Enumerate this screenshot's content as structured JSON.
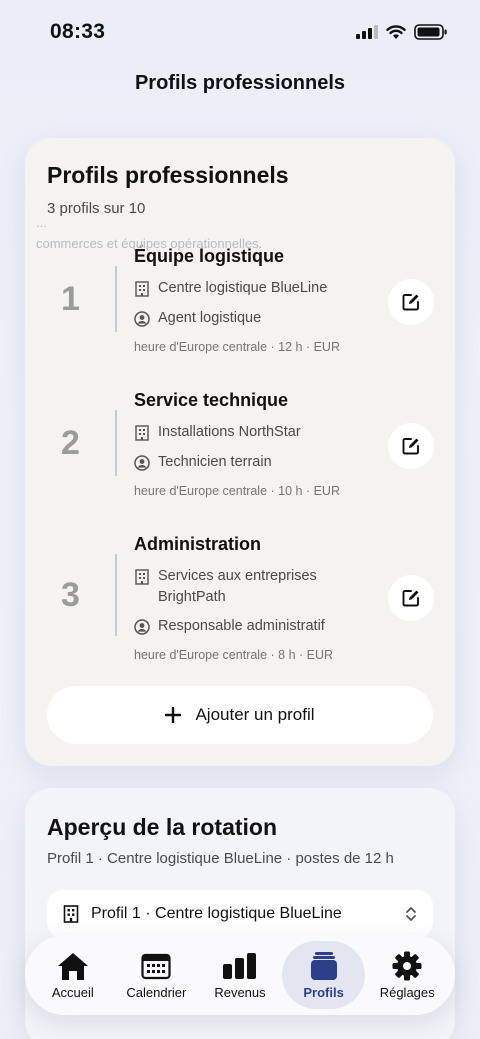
{
  "status": {
    "time": "08:33"
  },
  "nav": {
    "title": "Profils professionnels"
  },
  "profiles_card": {
    "title": "Profils professionnels",
    "subtitle": "3 profils sur 10",
    "profiles": [
      {
        "number": "1",
        "name": "Équipe logistique",
        "company": "Centre logistique BlueLine",
        "role": "Agent logistique",
        "meta": "heure d'Europe centrale · 12 h · EUR"
      },
      {
        "number": "2",
        "name": "Service technique",
        "company": "Installations NorthStar",
        "role": "Technicien terrain",
        "meta": "heure d'Europe centrale · 10 h · EUR"
      },
      {
        "number": "3",
        "name": "Administration",
        "company_line1": "Services aux entreprises",
        "company_line2": "BrightPath",
        "role": "Responsable administratif",
        "meta": "heure d'Europe centrale · 8 h · EUR"
      }
    ],
    "add_label": "Ajouter un profil"
  },
  "rotation_card": {
    "title": "Aperçu de la rotation",
    "subtitle": "Profil 1 · Centre logistique BlueLine · postes de 12 h",
    "select_value": "Profil 1 · Centre logistique BlueLine",
    "faded_line1": "...",
    "faded_line2": "commerces et équipes opérationnelles."
  },
  "tabs": [
    {
      "label": "Accueil",
      "icon": "home-icon"
    },
    {
      "label": "Calendrier",
      "icon": "calendar-icon"
    },
    {
      "label": "Revenus",
      "icon": "bar-chart-icon"
    },
    {
      "label": "Profils",
      "icon": "stack-icon",
      "active": true
    },
    {
      "label": "Réglages",
      "icon": "gear-icon"
    }
  ],
  "colors": {
    "accent": "#2b3f8a",
    "card": "#f5f3ef",
    "active_tab": "#e3e6f1"
  }
}
